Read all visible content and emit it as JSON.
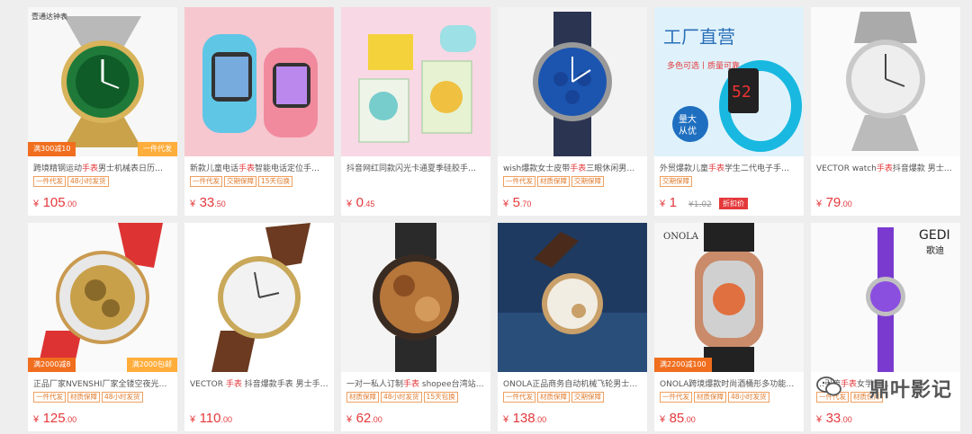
{
  "products": [
    {
      "title_pre": "跨境精钢运动",
      "title_hl": "手表",
      "title_post": "男士机械表日历…",
      "tags": [
        "一件代发",
        "48小时发货"
      ],
      "price_int": "105",
      "price_dec": ".00",
      "promo": [
        "满300减10",
        "一件代发"
      ],
      "badge": "壹通达钟表",
      "icon": "green-dial-watch-icon"
    },
    {
      "title_pre": "新款儿童电话",
      "title_hl": "手表",
      "title_post": "智能电话定位手…",
      "tags": [
        "一件代发",
        "交期保障",
        "15天包换"
      ],
      "price_int": "33",
      "price_dec": ".50",
      "icon": "kids-smartwatch-icon"
    },
    {
      "title_pre": "抖音网红同款闪光卡通夏季硅胶手…",
      "title_hl": "",
      "title_post": "",
      "tags": [],
      "price_int": "0",
      "price_dec": ".45",
      "icon": "cartoon-watch-icon"
    },
    {
      "title_pre": "wish爆款女士皮带",
      "title_hl": "手表",
      "title_post": "三眼休闲男…",
      "tags": [
        "一件代发",
        "材质保障",
        "交期保障"
      ],
      "price_int": "5",
      "price_dec": ".70",
      "icon": "blue-dial-watch-icon"
    },
    {
      "title_pre": "外贸爆款儿童",
      "title_hl": "手表",
      "title_post": "学生二代电子手…",
      "tags": [
        "交期保障"
      ],
      "price_int": "1",
      "price_dec": "",
      "old_price": "¥1.02",
      "discount": "折扣价",
      "banner": "工厂直营",
      "banner_sub": "多色可选丨质量可靠",
      "banner_badge": "量大从优",
      "icon": "led-watch-icon"
    },
    {
      "title_pre": "VECTOR watch",
      "title_hl": "手表",
      "title_post": "抖音爆款 男士时…",
      "tags": [],
      "price_int": "79",
      "price_dec": ".00",
      "icon": "steel-watch-icon"
    },
    {
      "title_pre": "正品厂家NVENSHI厂家全镂空夜光自…",
      "title_hl": "",
      "title_post": "",
      "tags": [
        "一件代发",
        "材质保障",
        "48小时发货"
      ],
      "price_int": "125",
      "price_dec": ".00",
      "promo": [
        "满2000减8",
        "满2000包邮"
      ],
      "icon": "skeleton-watch-icon"
    },
    {
      "title_pre": "VECTOR ",
      "title_hl": "手表",
      "title_post": " 抖音爆款手表 男士手…",
      "tags": [],
      "price_int": "110",
      "price_dec": ".00",
      "icon": "leather-watch-icon"
    },
    {
      "title_pre": "一对一私人订制",
      "title_hl": "手表",
      "title_post": " shopee台湾站…",
      "tags": [
        "材质保障",
        "48小时发货",
        "15天包换"
      ],
      "price_int": "62",
      "price_dec": ".00",
      "icon": "wood-watch-icon"
    },
    {
      "title_pre": "ONOLA正品商务自动机械飞轮男士",
      "title_hl": "手",
      "title_post": "…",
      "tags": [
        "一件代发",
        "材质保障",
        "交期保障"
      ],
      "price_int": "138",
      "price_dec": ".00",
      "icon": "mechanical-watch-icon"
    },
    {
      "title_pre": "ONOLA跨境爆款时尚酒桶形多功能石…",
      "title_hl": "",
      "title_post": "",
      "tags": [
        "一件代发",
        "材质保障",
        "48小时发货"
      ],
      "price_int": "85",
      "price_dec": ".00",
      "promo": [
        "满2200减100"
      ],
      "brand_logo": "ONOLA",
      "icon": "tonneau-watch-icon"
    },
    {
      "title_pre": "…引流",
      "title_hl": "手表",
      "title_post": "女学生…",
      "tags": [
        "一件代发",
        "材质保障"
      ],
      "price_int": "33",
      "price_dec": ".00",
      "brand_logo": "GEDI",
      "brand_cn": "歌迪",
      "icon": "purple-bracelet-watch-icon"
    }
  ],
  "currency": "¥",
  "watermark": "鼎叶影记",
  "colors": {
    "price": "#e4393c",
    "tag": "#e07a2c",
    "promo": "#f06e1e"
  }
}
